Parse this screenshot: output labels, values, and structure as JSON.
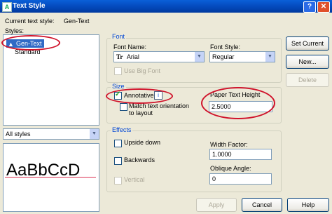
{
  "window": {
    "title": "Text Style",
    "help": "?",
    "close": "✕",
    "app_icon": "A"
  },
  "current_style": {
    "label": "Current text style:",
    "value": "Gen-Text"
  },
  "styles": {
    "label": "Styles:",
    "items": [
      "Gen-Text",
      "Standard"
    ],
    "selected": "Gen-Text",
    "selected_icon": "annotative-triangle-icon"
  },
  "filter": {
    "value": "All styles"
  },
  "preview": {
    "sample": "AaBbCcD"
  },
  "font": {
    "group": "Font",
    "name_label": "Font Name:",
    "name_value": "Arial",
    "name_icon": "Tr",
    "style_label": "Font Style:",
    "style_value": "Regular",
    "big_font_label": "Use Big Font"
  },
  "size": {
    "group": "Size",
    "annotative_label": "Annotative",
    "annotative_checked": true,
    "info_icon": "i",
    "match_label_1": "Match text orientation",
    "match_label_2": "to layout",
    "paper_height_label": "Paper Text Height",
    "paper_height_value": "2.5000"
  },
  "effects": {
    "group": "Effects",
    "upside_down": "Upside down",
    "backwards": "Backwards",
    "vertical": "Vertical",
    "width_factor_label": "Width Factor:",
    "width_factor_value": "1.0000",
    "oblique_label": "Oblique Angle:",
    "oblique_value": "0"
  },
  "buttons": {
    "set_current": "Set Current",
    "new": "New...",
    "delete": "Delete",
    "apply": "Apply",
    "cancel": "Cancel",
    "help": "Help"
  },
  "colors": {
    "title_bar": "#0347b8",
    "highlight": "#316ac5",
    "annotation_circle": "#d0122a",
    "dialog_bg": "#ece9d8"
  }
}
